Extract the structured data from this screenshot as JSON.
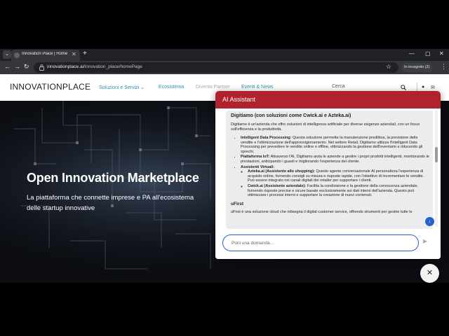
{
  "browser": {
    "tab_title": "Innovation Place | Home",
    "tab_close": "✕",
    "new_tab": "+",
    "url_domain": "innovationplace.ai",
    "url_path": "/innovation_place/homePage",
    "incognito_label": "In incognito (2)"
  },
  "site": {
    "logo": "INNOVATIONPLACE",
    "nav": {
      "solutions": "Soluzioni e Servizi",
      "ecosystem": "Ecosistema",
      "become_partner": "Diventa Partner",
      "events": "Eventi & News"
    },
    "search_label": "Cerca"
  },
  "hero": {
    "title": "Open Innovation Marketplace",
    "subtitle": "La piattaforma che connette imprese e PA all'ecosistema delle startup innovative"
  },
  "assistant": {
    "title": "AI Assistant",
    "message": {
      "heading": "Digitiamo (con soluzioni come Cwick.ai e Azteka.ai)",
      "intro": "Digitiamo è un'azienda che offre soluzioni di intelligenza artificiale per diverse esigenze aziendali, con un focus sull'efficienza e la produttività.",
      "items": [
        {
          "label": "Intelligent Data Processing:",
          "text": " Questa soluzione permette la manutenzione predittiva, la previsione delle vendite e l'ottimizzazione dell'approvvigionamento. Nel settore Retail, Digitiamo utilizza l'Intelligent Data Processing per prevedere le vendite online e offline, ottimizzando la gestione dell'inventario e riducendo gli sprechi."
        },
        {
          "label": "Piattaforma IoT:",
          "text": " Attraverso l'AI, Digitiamo aiuta le aziende a gestire i propri prodotti intelligenti, monitorando le prestazioni, anticipando i guasti e migliorando l'esperienza del cliente."
        },
        {
          "label": "Assistenti Virtuali:",
          "text": ""
        }
      ],
      "subitems": [
        {
          "label": "Azteka.ai (Assistente allo shopping):",
          "text": " Questo agente conversazionale AI personalizza l'esperienza di acquisto online, fornendo consigli su misura e risposte rapide, con l'obiettivo di incrementare le vendite. Può essere integrato nei canali digitali dei retailer per supportare i clienti."
        },
        {
          "label": "Cwick.ai (Assistente aziendale):",
          "text": " Facilita la condivisione e la gestione della conoscenza aziendale, fornendo risposte precise e sicure basate esclusivamente sui dati interni dell'azienda. Questo può ottimizzare i processi interni e supportare la creazione di nuovi contenuti."
        }
      ],
      "section2": "uFirst",
      "section2_text": "uFirst è una soluzione cloud che ridisegna il digital customer service, offrendo strumenti per gestire tutte le"
    },
    "input_placeholder": "Poni una domanda...",
    "send_glyph": "➤",
    "scroll_glyph": "↓",
    "close_glyph": "✕"
  },
  "colors": {
    "assistant_header": "#b0232c",
    "nav_link": "#2b8fb3",
    "accent_blue": "#2563c9"
  }
}
